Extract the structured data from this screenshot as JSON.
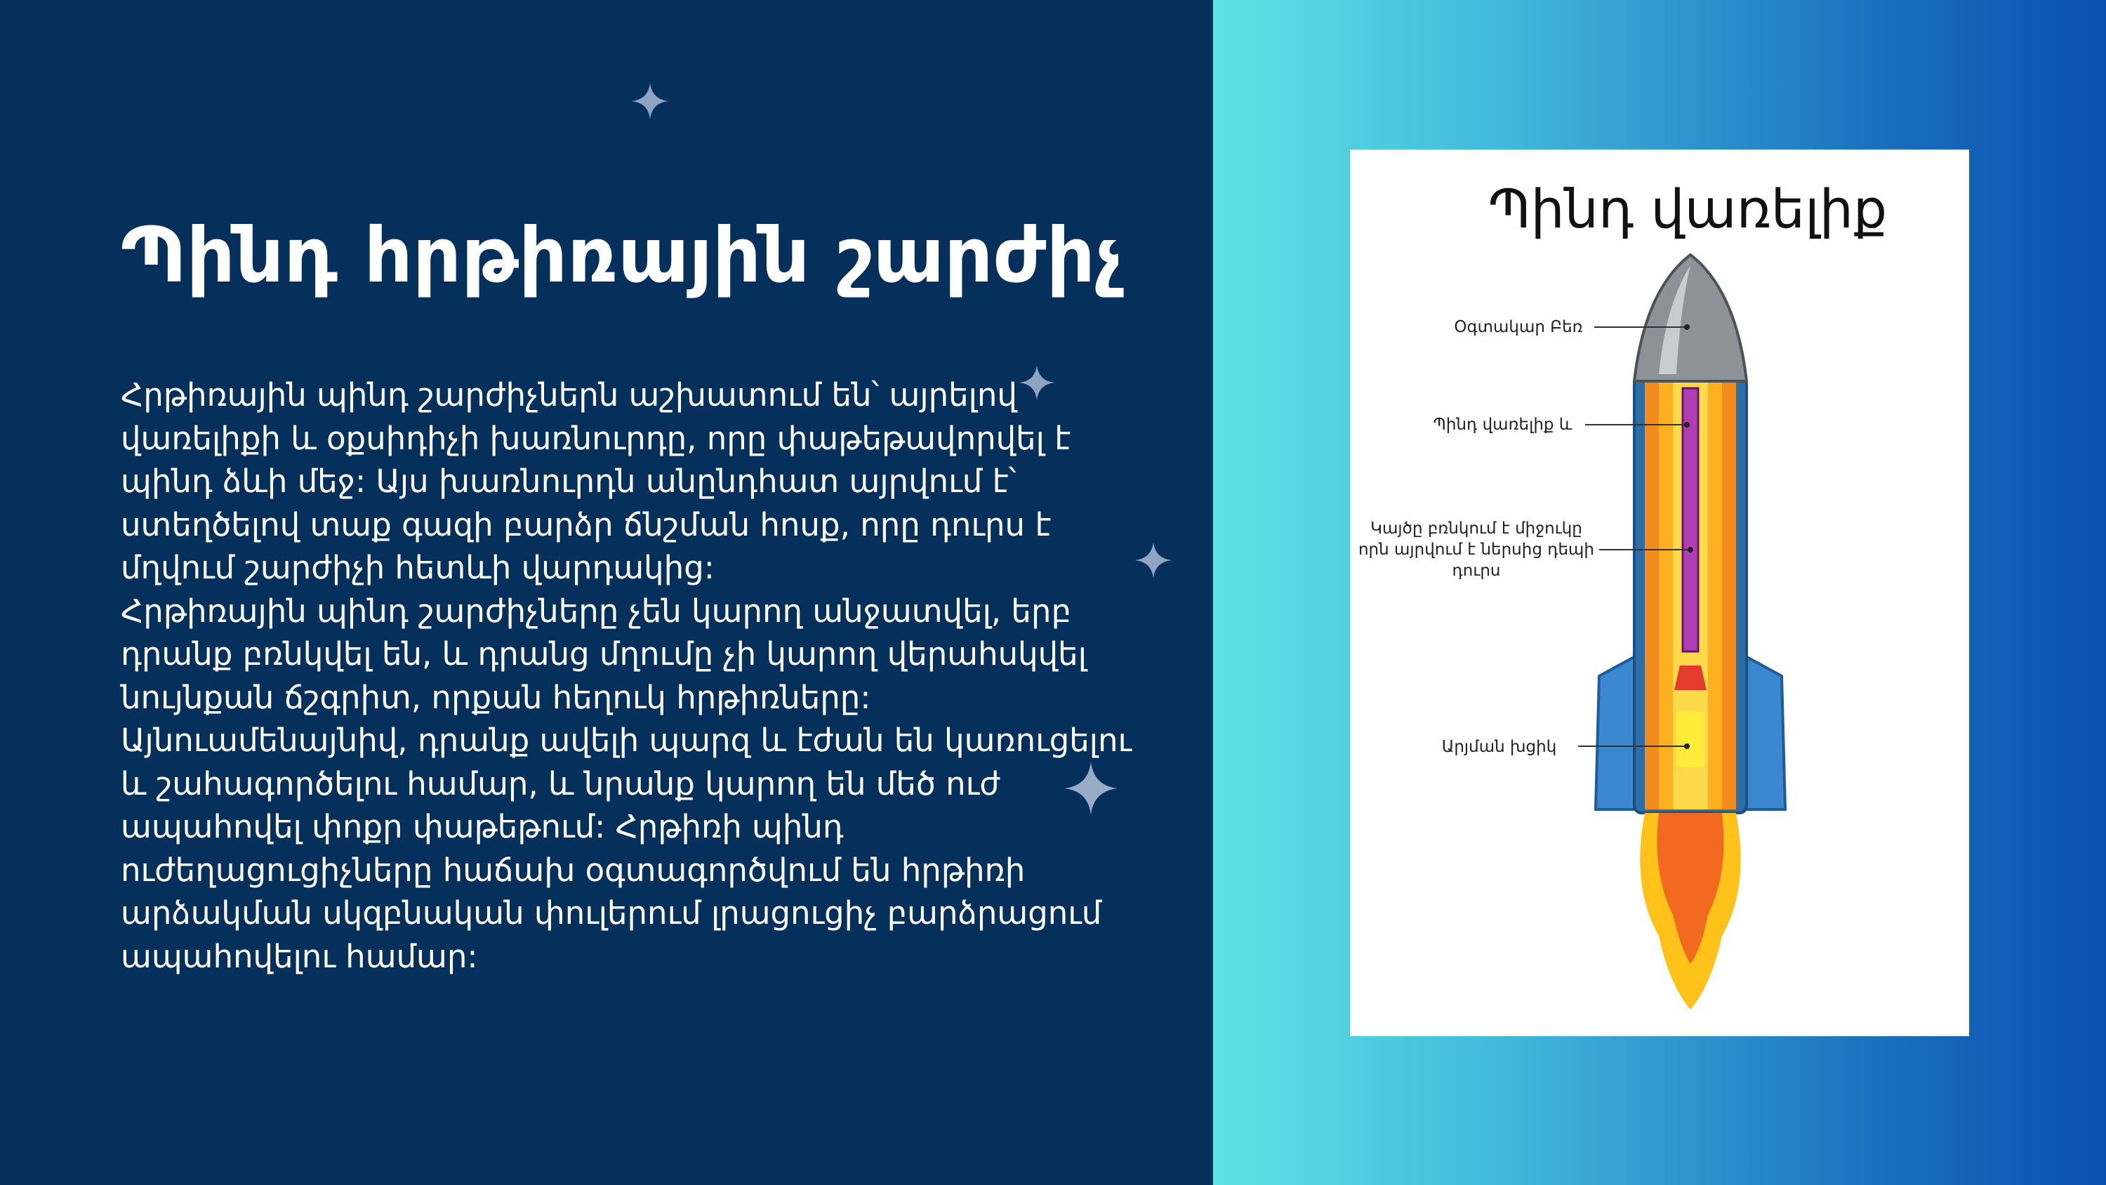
{
  "slide": {
    "title": "Պինդ հրթիռային շարժիչ",
    "paragraph_1": "Հրթիռային պինդ շարժիչներն աշխատում են՝ այրելով վառելիքի և օքսիդիչի խառնուրդը, որը փաթեթավորվել է պինդ ձևի մեջ: Այս խառնուրդն անընդհատ այրվում է՝ ստեղծելով տաք գազի բարձր ճնշման հոսք, որը դուրս է մղվում շարժիչի հետևի վարդակից:",
    "paragraph_2": "Հրթիռային պինդ շարժիչները չեն կարող անջատվել, երբ դրանք բռնկվել են, և դրանց մղումը չի կարող վերահսկվել նույնքան ճշգրիտ, որքան հեղուկ հրթիռները: Այնուամենայնիվ, դրանք ավելի պարզ և էժան են կառուցելու և շահագործելու համար, և նրանք կարող են մեծ ուժ ապահովել փոքր փաթեթում: Հրթիռի պինդ ուժեղացուցիչները հաճախ օգտագործվում են հրթիռի արձակման սկզբնական փուլերում լրացուցիչ բարձրացում ապահովելու համար:"
  },
  "diagram": {
    "title": "Պինդ վառելիք",
    "labels": {
      "nose": "Օգտակար Բեռ",
      "fuel": "Պինդ վառելիք և",
      "core_line1": "Կայծը բռնկում է միջուկը",
      "core_line2": "որն այրվում է ներսից դեպի",
      "core_line3": "դուրս",
      "nozzle": "Արյման խցիկ"
    }
  },
  "colors": {
    "background": "#05305c",
    "gradient_start": "#5fe3e6",
    "gradient_end": "#0b4fb0",
    "text": "#ffffff"
  }
}
